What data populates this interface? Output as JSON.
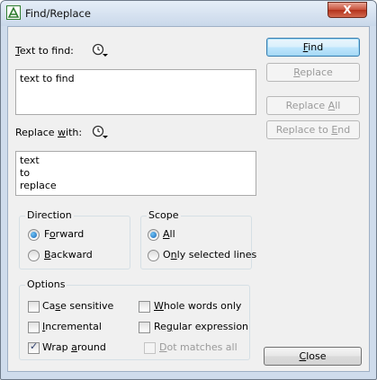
{
  "window": {
    "title": "Find/Replace",
    "close_glyph": "X"
  },
  "find": {
    "label_first": "T",
    "label_rest": "ext to find:",
    "value": "text to find"
  },
  "replace": {
    "label_first": "Replace ",
    "label_u": "w",
    "label_rest": "ith:",
    "value": "text\nto\nreplace"
  },
  "buttons": {
    "find_u": "F",
    "find_rest": "ind",
    "replace_first": "",
    "replace_u": "R",
    "replace_rest": "eplace",
    "replace_all_first": "Replace ",
    "replace_all_u": "A",
    "replace_all_rest": "ll",
    "replace_to_end_first": "Replace to ",
    "replace_to_end_u": "E",
    "replace_to_end_rest": "nd",
    "close_u": "C",
    "close_rest": "lose"
  },
  "direction": {
    "title": "Direction",
    "forward_first": "F",
    "forward_u": "o",
    "forward_rest": "rward",
    "backward_u": "B",
    "backward_rest": "ackward",
    "selected": "forward"
  },
  "scope": {
    "title": "Scope",
    "all_u": "A",
    "all_rest": "ll",
    "selected_first": "O",
    "selected_u": "n",
    "selected_rest": "ly selected lines",
    "selected": "all"
  },
  "options": {
    "title": "Options",
    "case_first": "Ca",
    "case_u": "s",
    "case_rest": "e sensitive",
    "case_checked": false,
    "whole_u": "W",
    "whole_rest": "hole words only",
    "whole_checked": false,
    "incr_u": "I",
    "incr_rest": "ncremental",
    "incr_checked": false,
    "regex_first": "Re",
    "regex_u": "g",
    "regex_rest": "ular expression",
    "regex_checked": false,
    "wrap_first": "Wrap ",
    "wrap_u": "a",
    "wrap_rest": "round",
    "wrap_checked": true,
    "dot_u": "D",
    "dot_rest": "ot matches all",
    "dot_checked": false
  },
  "colors": {
    "titlebar": "#c9d8ea",
    "dialog_bg": "#f0f0f0",
    "close_red": "#c7503a",
    "radio_dot": "#1a67b8"
  },
  "icons": {
    "app": "find-replace-app-icon",
    "history": "history-dropdown-icon"
  }
}
